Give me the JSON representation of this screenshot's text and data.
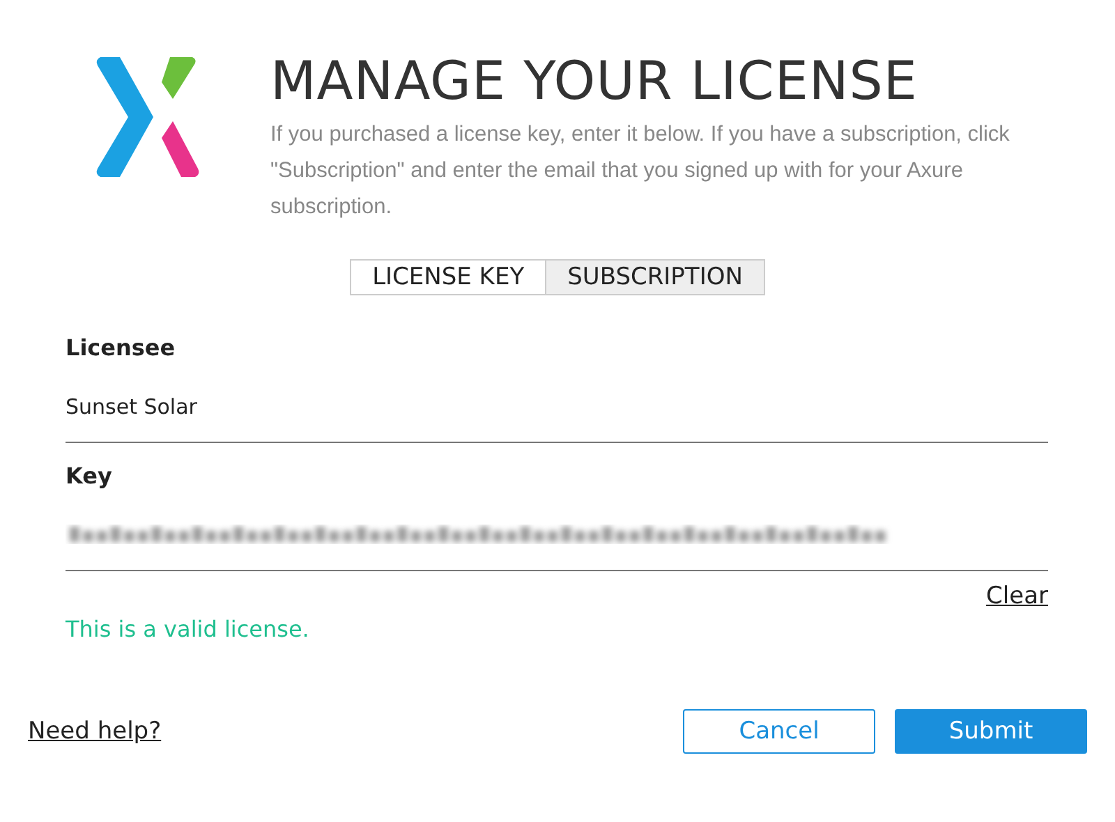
{
  "title": "MANAGE YOUR LICENSE",
  "description": "If you purchased a license key, enter it below. If you have a subscription, click \"Subscription\" and enter the email that you signed up with for your Axure subscription.",
  "tabs": [
    {
      "label": "LICENSE KEY",
      "selected": true
    },
    {
      "label": "SUBSCRIPTION",
      "selected": false
    }
  ],
  "licensee": {
    "label": "Licensee",
    "value": "Sunset Solar"
  },
  "key": {
    "label": "Key",
    "obscured": true
  },
  "clear_link": "Clear",
  "status": "This is a valid license.",
  "help_link": "Need help?",
  "buttons": [
    {
      "label": "Cancel",
      "kind": "secondary"
    },
    {
      "label": "Submit",
      "kind": "primary"
    }
  ]
}
